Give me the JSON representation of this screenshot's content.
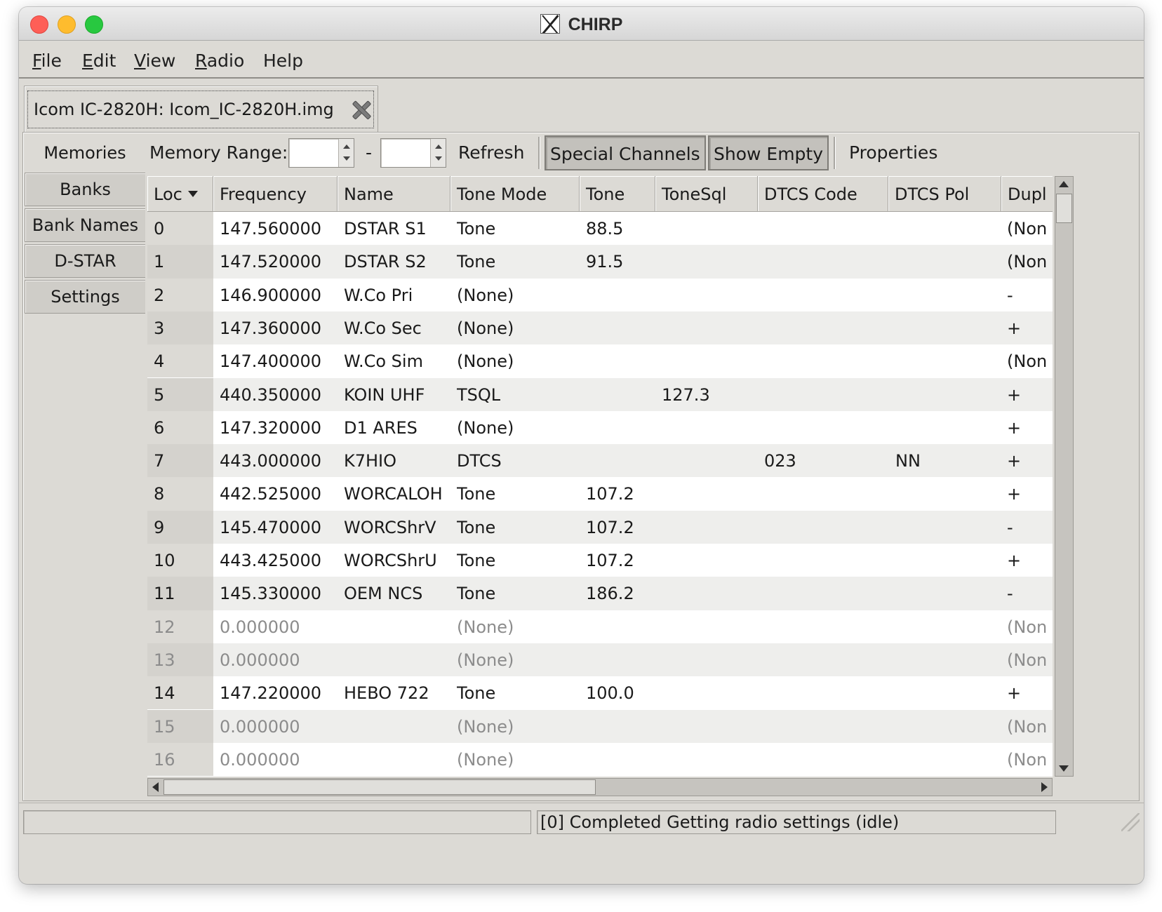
{
  "window": {
    "title": "CHIRP"
  },
  "menu": [
    {
      "mnemonic": "F",
      "rest": "ile"
    },
    {
      "mnemonic": "E",
      "rest": "dit"
    },
    {
      "mnemonic": "V",
      "rest": "iew"
    },
    {
      "mnemonic": "R",
      "rest": "adio"
    },
    {
      "mnemonic": "",
      "rest": "Help"
    }
  ],
  "file_tab": {
    "label": "Icom IC-2820H: Icom_IC-2820H.img",
    "close_icon": "close-icon"
  },
  "side_tabs": [
    "Memories",
    "Banks",
    "Bank Names",
    "D-STAR",
    "Settings"
  ],
  "side_tabs_active": "Memories",
  "toolbar": {
    "memory_range_label": "Memory Range:",
    "range_start": "",
    "range_end": "",
    "range_separator": "-",
    "refresh": "Refresh",
    "special_channels": "Special Channels",
    "show_empty": "Show Empty",
    "properties": "Properties"
  },
  "columns": [
    "Loc",
    "Frequency",
    "Name",
    "Tone Mode",
    "Tone",
    "ToneSql",
    "DTCS Code",
    "DTCS Pol",
    "Dupl"
  ],
  "sort": {
    "column": "Loc",
    "direction": "descending-arrow"
  },
  "rows": [
    {
      "loc": "0",
      "freq": "147.560000",
      "name": "DSTAR S1",
      "mode": "Tone",
      "tone": "88.5",
      "tsql": "",
      "dtcs": "",
      "pol": "",
      "dup": "(Non",
      "empty": false
    },
    {
      "loc": "1",
      "freq": "147.520000",
      "name": "DSTAR S2",
      "mode": "Tone",
      "tone": "91.5",
      "tsql": "",
      "dtcs": "",
      "pol": "",
      "dup": "(Non",
      "empty": false
    },
    {
      "loc": "2",
      "freq": "146.900000",
      "name": "W.Co Pri",
      "mode": "(None)",
      "tone": "",
      "tsql": "",
      "dtcs": "",
      "pol": "",
      "dup": "-",
      "empty": false
    },
    {
      "loc": "3",
      "freq": "147.360000",
      "name": "W.Co Sec",
      "mode": "(None)",
      "tone": "",
      "tsql": "",
      "dtcs": "",
      "pol": "",
      "dup": "+",
      "empty": false
    },
    {
      "loc": "4",
      "freq": "147.400000",
      "name": "W.Co Sim",
      "mode": "(None)",
      "tone": "",
      "tsql": "",
      "dtcs": "",
      "pol": "",
      "dup": "(Non",
      "empty": false
    },
    {
      "loc": "5",
      "freq": "440.350000",
      "name": "KOIN UHF",
      "mode": "TSQL",
      "tone": "",
      "tsql": "127.3",
      "dtcs": "",
      "pol": "",
      "dup": "+",
      "empty": false
    },
    {
      "loc": "6",
      "freq": "147.320000",
      "name": "D1 ARES",
      "mode": "(None)",
      "tone": "",
      "tsql": "",
      "dtcs": "",
      "pol": "",
      "dup": "+",
      "empty": false
    },
    {
      "loc": "7",
      "freq": "443.000000",
      "name": "K7HIO",
      "mode": "DTCS",
      "tone": "",
      "tsql": "",
      "dtcs": "023",
      "pol": "NN",
      "dup": "+",
      "empty": false
    },
    {
      "loc": "8",
      "freq": "442.525000",
      "name": "WORCALOH",
      "mode": "Tone",
      "tone": "107.2",
      "tsql": "",
      "dtcs": "",
      "pol": "",
      "dup": "+",
      "empty": false
    },
    {
      "loc": "9",
      "freq": "145.470000",
      "name": "WORCShrV",
      "mode": "Tone",
      "tone": "107.2",
      "tsql": "",
      "dtcs": "",
      "pol": "",
      "dup": "-",
      "empty": false
    },
    {
      "loc": "10",
      "freq": "443.425000",
      "name": "WORCShrU",
      "mode": "Tone",
      "tone": "107.2",
      "tsql": "",
      "dtcs": "",
      "pol": "",
      "dup": "+",
      "empty": false
    },
    {
      "loc": "11",
      "freq": "145.330000",
      "name": "OEM NCS",
      "mode": "Tone",
      "tone": "186.2",
      "tsql": "",
      "dtcs": "",
      "pol": "",
      "dup": "-",
      "empty": false
    },
    {
      "loc": "12",
      "freq": "0.000000",
      "name": "",
      "mode": "(None)",
      "tone": "",
      "tsql": "",
      "dtcs": "",
      "pol": "",
      "dup": "(Non",
      "empty": true
    },
    {
      "loc": "13",
      "freq": "0.000000",
      "name": "",
      "mode": "(None)",
      "tone": "",
      "tsql": "",
      "dtcs": "",
      "pol": "",
      "dup": "(Non",
      "empty": true
    },
    {
      "loc": "14",
      "freq": "147.220000",
      "name": "HEBO 722",
      "mode": "Tone",
      "tone": "100.0",
      "tsql": "",
      "dtcs": "",
      "pol": "",
      "dup": "+",
      "empty": false
    },
    {
      "loc": "15",
      "freq": "0.000000",
      "name": "",
      "mode": "(None)",
      "tone": "",
      "tsql": "",
      "dtcs": "",
      "pol": "",
      "dup": "(Non",
      "empty": true
    },
    {
      "loc": "16",
      "freq": "0.000000",
      "name": "",
      "mode": "(None)",
      "tone": "",
      "tsql": "",
      "dtcs": "",
      "pol": "",
      "dup": "(Non",
      "empty": true
    }
  ],
  "status": {
    "left": "",
    "right": "[0] Completed Getting radio settings (idle)"
  }
}
